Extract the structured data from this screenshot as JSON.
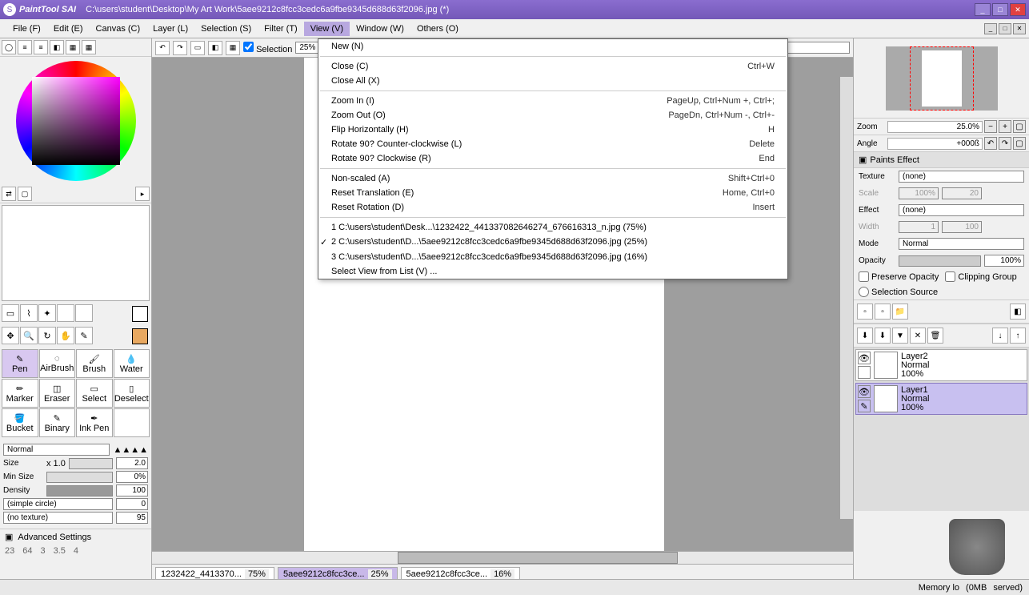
{
  "app": {
    "name": "PaintTool SAI",
    "filepath": "C:\\users\\student\\Desktop\\My Art Work\\5aee9212c8fcc3cedc6a9fbe9345d688d63f2096.jpg (*)"
  },
  "menus": {
    "file": "File (F)",
    "edit": "Edit (E)",
    "canvas": "Canvas (C)",
    "layer": "Layer (L)",
    "selection": "Selection (S)",
    "filter": "Filter (T)",
    "view": "View (V)",
    "window": "Window (W)",
    "others": "Others (O)"
  },
  "view_menu": {
    "new": {
      "label": "New (N)"
    },
    "close": {
      "label": "Close (C)",
      "sc": "Ctrl+W"
    },
    "close_all": {
      "label": "Close All (X)"
    },
    "zoom_in": {
      "label": "Zoom In (I)",
      "sc": "PageUp, Ctrl+Num +, Ctrl+;"
    },
    "zoom_out": {
      "label": "Zoom Out (O)",
      "sc": "PageDn, Ctrl+Num -, Ctrl+-"
    },
    "flip_h": {
      "label": "Flip Horizontally (H)",
      "sc": "H"
    },
    "rot_ccw": {
      "label": "Rotate 90? Counter-clockwise (L)",
      "sc": "Delete"
    },
    "rot_cw": {
      "label": "Rotate 90? Clockwise (R)",
      "sc": "End"
    },
    "nonscaled": {
      "label": "Non-scaled (A)",
      "sc": "Shift+Ctrl+0"
    },
    "reset_trans": {
      "label": "Reset Translation (E)",
      "sc": "Home, Ctrl+0"
    },
    "reset_rot": {
      "label": "Reset Rotation (D)",
      "sc": "Insert"
    },
    "doc1": {
      "label": "1 C:\\users\\student\\Desk...\\1232422_441337082646274_676616313_n.jpg (75%)"
    },
    "doc2": {
      "label": "2 C:\\users\\student\\D...\\5aee9212c8fcc3cedc6a9fbe9345d688d63f2096.jpg (25%)",
      "checked": "✓"
    },
    "doc3": {
      "label": "3 C:\\users\\student\\D...\\5aee9212c8fcc3cedc6a9fbe9345d688d63f2096.jpg (16%)"
    },
    "select_list": {
      "label": "Select View from List (V) ..."
    }
  },
  "canvas_tb": {
    "selection_label": "Selection",
    "zoom": "25%"
  },
  "tools": {
    "pen": "Pen",
    "airbrush": "AirBrush",
    "brush": "Brush",
    "water": "Water",
    "marker": "Marker",
    "eraser": "Eraser",
    "select": "Select",
    "deselect": "Deselect",
    "bucket": "Bucket",
    "binary": "Binary",
    "inkpen": "Ink Pen"
  },
  "brush": {
    "mode": "Normal",
    "size_label": "Size",
    "size_mult": "x 1.0",
    "size_val": "2.0",
    "minsize_label": "Min Size",
    "minsize_val": "0%",
    "density_label": "Density",
    "density_val": "100",
    "shape": "(simple circle)",
    "shape_val": "0",
    "texture": "(no texture)",
    "texture_val": "95",
    "advanced": "Advanced Settings"
  },
  "right": {
    "zoom_label": "Zoom",
    "zoom_val": "25.0%",
    "angle_label": "Angle",
    "angle_val": "+000ß",
    "paints_effect": "Paints Effect",
    "texture_label": "Texture",
    "texture_val": "(none)",
    "scale_label": "Scale",
    "scale_val": "100%",
    "scale_num": "20",
    "effect_label": "Effect",
    "effect_val": "(none)",
    "width_label": "Width",
    "width_val": "1",
    "width_num": "100",
    "mode_label": "Mode",
    "mode_val": "Normal",
    "opacity_label": "Opacity",
    "opacity_val": "100%",
    "preserve_opacity": "Preserve Opacity",
    "clipping_group": "Clipping Group",
    "selection_source": "Selection Source"
  },
  "layers": [
    {
      "name": "Layer2",
      "mode": "Normal",
      "opacity": "100%"
    },
    {
      "name": "Layer1",
      "mode": "Normal",
      "opacity": "100%"
    }
  ],
  "tabs": [
    {
      "name": "1232422_4413370...",
      "pct": "75%"
    },
    {
      "name": "5aee9212c8fcc3ce...",
      "pct": "25%"
    },
    {
      "name": "5aee9212c8fcc3ce...",
      "pct": "16%"
    }
  ],
  "status": {
    "mem_label": "Memory lo",
    "mem_val": "(0MB",
    "res": "served)"
  },
  "ruler": [
    "23",
    "64",
    "3",
    "3.5",
    "4"
  ]
}
